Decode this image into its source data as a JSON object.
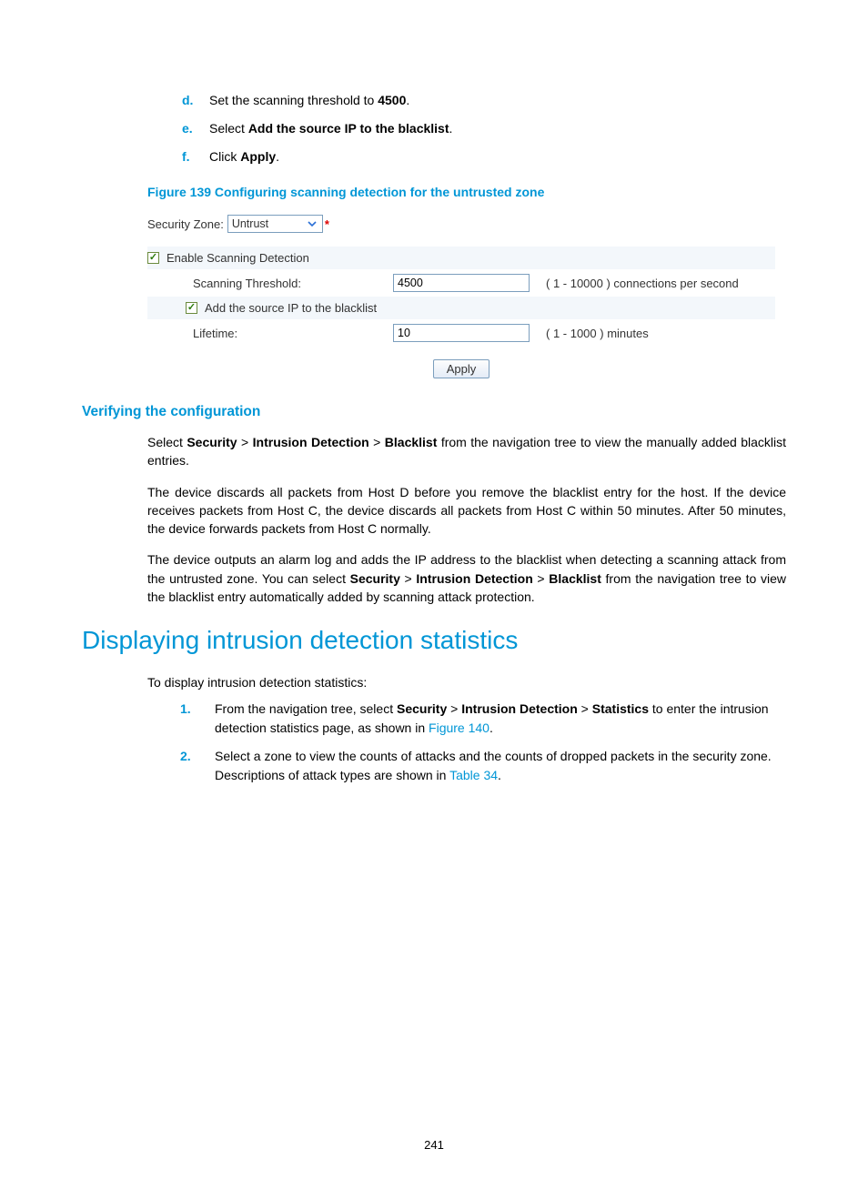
{
  "steps_alpha": {
    "d": {
      "marker": "d.",
      "pre": "Set the scanning threshold to ",
      "bold": "4500",
      "post": "."
    },
    "e": {
      "marker": "e.",
      "pre": "Select ",
      "bold": "Add the source IP to the blacklist",
      "post": "."
    },
    "f": {
      "marker": "f.",
      "pre": "Click ",
      "bold": "Apply",
      "post": "."
    }
  },
  "figure_caption": "Figure 139 Configuring scanning detection for the untrusted zone",
  "config": {
    "zone_label": "Security Zone:",
    "zone_value": "Untrust",
    "enable_label": "Enable Scanning Detection",
    "threshold_label": "Scanning Threshold:",
    "threshold_value": "4500",
    "threshold_hint": "( 1 - 10000 ) connections per second",
    "blacklist_label": "Add the source IP to the blacklist",
    "lifetime_label": "Lifetime:",
    "lifetime_value": "10",
    "lifetime_hint": "( 1 - 1000 ) minutes",
    "apply_label": "Apply"
  },
  "verify_heading": "Verifying the configuration",
  "verify_p1": {
    "pre": "Select ",
    "b1": "Security",
    "s1": " > ",
    "b2": "Intrusion Detection",
    "s2": " > ",
    "b3": "Blacklist",
    "post": " from the navigation tree to view the manually added blacklist entries."
  },
  "verify_p2": "The device discards all packets from Host D before you remove the blacklist entry for the host. If the device receives packets from Host C, the device discards all packets from Host C within 50 minutes. After 50 minutes, the device forwards packets from Host C normally.",
  "verify_p3": {
    "pre": "The device outputs an alarm log and adds the IP address to the blacklist when detecting a scanning attack from the untrusted zone. You can select ",
    "b1": "Security",
    "s1": " > ",
    "b2": "Intrusion Detection",
    "s2": " > ",
    "b3": "Blacklist",
    "post": " from the navigation tree to view the blacklist entry automatically added by scanning attack protection."
  },
  "main_heading": "Displaying intrusion detection statistics",
  "stats_intro": "To display intrusion detection statistics:",
  "steps_num": {
    "1": {
      "marker": "1.",
      "pre": "From the navigation tree, select ",
      "b1": "Security",
      "s1": " > ",
      "b2": "Intrusion Detection",
      "s2": " > ",
      "b3": "Statistics",
      "mid": " to enter the intrusion detection statistics page, as shown in ",
      "link": "Figure 140",
      "post": "."
    },
    "2": {
      "marker": "2.",
      "pre": "Select a zone to view the counts of attacks and the counts of dropped packets in the security zone. Descriptions of attack types are shown in ",
      "link": "Table 34",
      "post": "."
    }
  },
  "page_number": "241"
}
